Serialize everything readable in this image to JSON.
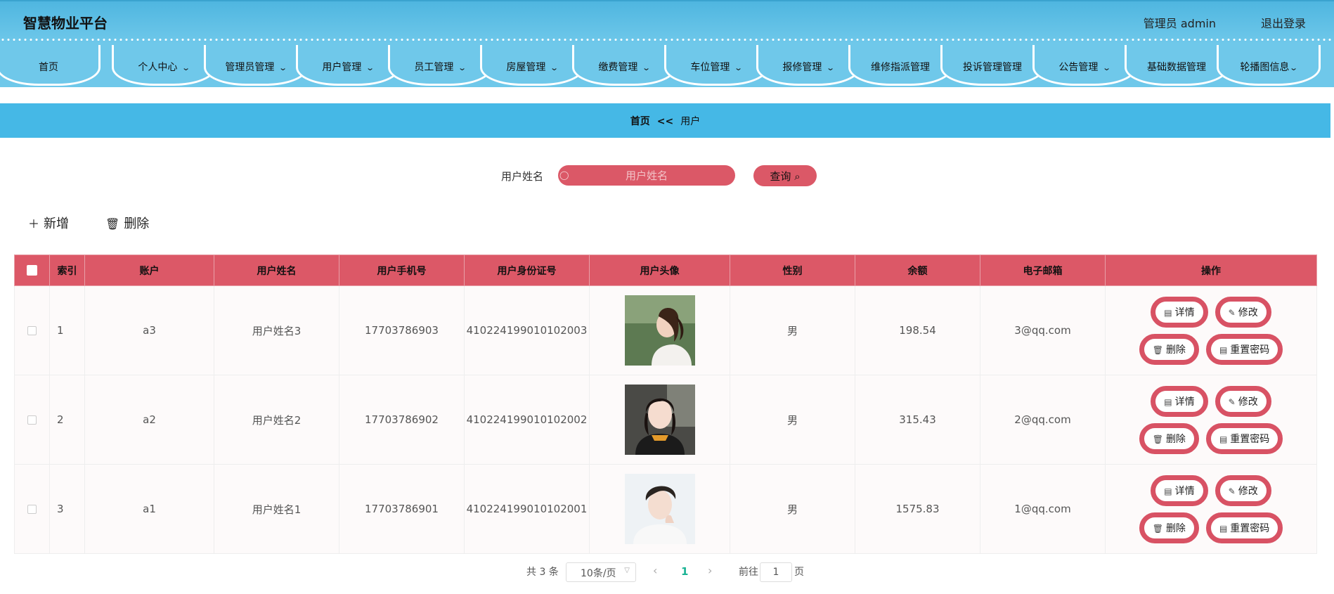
{
  "header": {
    "brand": "智慧物业平台",
    "admin": "管理员 admin",
    "logout": "退出登录"
  },
  "nav": [
    {
      "label": "首页",
      "chevron": false
    },
    {
      "label": "个人中心",
      "chevron": true
    },
    {
      "label": "管理员管理",
      "chevron": true
    },
    {
      "label": "用户管理",
      "chevron": true
    },
    {
      "label": "员工管理",
      "chevron": true
    },
    {
      "label": "房屋管理",
      "chevron": true
    },
    {
      "label": "缴费管理",
      "chevron": true
    },
    {
      "label": "车位管理",
      "chevron": true
    },
    {
      "label": "报修管理",
      "chevron": true
    },
    {
      "label": "维修指派管理",
      "chevron": false
    },
    {
      "label": "投诉管理管理",
      "chevron": false
    },
    {
      "label": "公告管理",
      "chevron": true
    },
    {
      "label": "基础数据管理",
      "chevron": false
    },
    {
      "label": "轮播图信息",
      "chevron": true
    }
  ],
  "breadcrumb": {
    "home": "首页",
    "sep": "<<",
    "current": "用户"
  },
  "search": {
    "label": "用户姓名",
    "placeholder": "用户姓名",
    "button": "查询"
  },
  "toolbar": {
    "add": "新增",
    "delete": "删除"
  },
  "table": {
    "headers": [
      "索引",
      "账户",
      "用户姓名",
      "用户手机号",
      "用户身份证号",
      "用户头像",
      "性别",
      "余额",
      "电子邮箱",
      "操作"
    ],
    "rows": [
      {
        "index": "1",
        "account": "a3",
        "name": "用户姓名3",
        "phone": "17703786903",
        "idcard": "410224199010102003",
        "avatar": "woman-ponytail-photo",
        "gender": "男",
        "balance": "198.54",
        "email": "3@qq.com"
      },
      {
        "index": "2",
        "account": "a2",
        "name": "用户姓名2",
        "phone": "17703786902",
        "idcard": "410224199010102002",
        "avatar": "woman-portrait-photo",
        "gender": "男",
        "balance": "315.43",
        "email": "2@qq.com"
      },
      {
        "index": "3",
        "account": "a1",
        "name": "用户姓名1",
        "phone": "17703786901",
        "idcard": "410224199010102001",
        "avatar": "man-portrait-photo",
        "gender": "男",
        "balance": "1575.83",
        "email": "1@qq.com"
      }
    ],
    "ops": {
      "detail": "详情",
      "edit": "修改",
      "delete": "删除",
      "reset": "重置密码"
    }
  },
  "pagination": {
    "total": "共 3 条",
    "page_size": "10条/页",
    "current": "1",
    "goto_label": "前往",
    "goto_value": "1",
    "page_suffix": "页"
  },
  "colors": {
    "accent": "#db5867",
    "header_blue": "#6fc8ea",
    "breadcrumb_blue": "#45b8e6",
    "active_page": "#1ab394"
  }
}
